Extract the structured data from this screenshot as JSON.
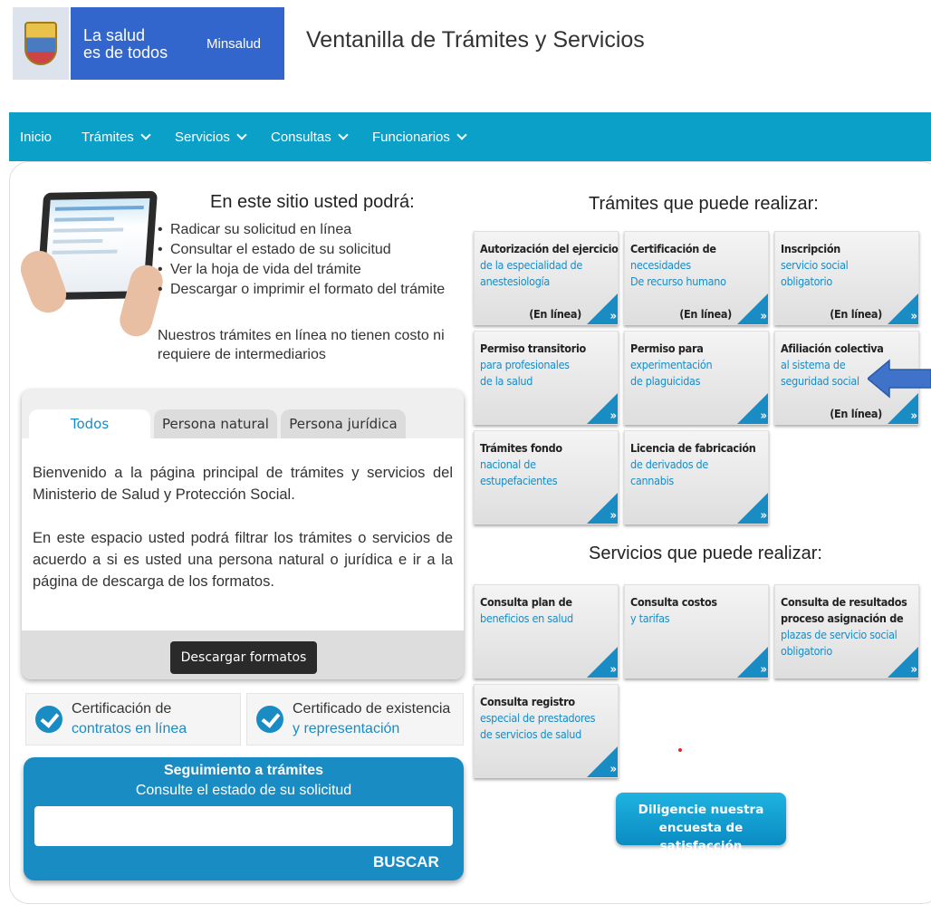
{
  "header": {
    "brand_line1": "La salud",
    "brand_line2": "es de todos",
    "brand_name": "Minsalud",
    "site_title": "Ventanilla de Trámites y Servicios"
  },
  "nav": {
    "items": [
      {
        "label": "Inicio",
        "has_dropdown": false
      },
      {
        "label": "Trámites",
        "has_dropdown": true
      },
      {
        "label": "Servicios",
        "has_dropdown": true
      },
      {
        "label": "Consultas",
        "has_dropdown": true
      },
      {
        "label": "Funcionarios",
        "has_dropdown": true
      }
    ]
  },
  "intro": {
    "heading": "En este sitio usted podrá:",
    "features": [
      "Radicar su solicitud en línea",
      "Consultar el estado de su solicitud",
      "Ver la hoja de vida del trámite",
      "Descargar o imprimir el formato del trámite"
    ],
    "note": "Nuestros trámites en línea no tienen costo ni requiere de intermediarios"
  },
  "tabs": {
    "items": [
      "Todos",
      "Persona natural",
      "Persona jurídica"
    ],
    "active": "Todos",
    "paragraph1": "Bienvenido a la página principal de trámites y servicios del Ministerio de Salud y Protección Social.",
    "paragraph2": "En este espacio usted podrá filtrar los trámites o servicios de acuerdo a si es usted una persona natural o jurídica e ir a la página de descarga de los formatos.",
    "download_button": "Descargar formatos"
  },
  "certs": [
    {
      "line1": "Certificación de",
      "line2": "contratos en línea"
    },
    {
      "line1": "Certificado de existencia",
      "line2": "y representación"
    }
  ],
  "tracking": {
    "title": "Seguimiento a trámites",
    "subtitle": "Consulte el estado de su solicitud",
    "input_value": "",
    "button": "BUSCAR"
  },
  "tramites": {
    "heading": "Trámites que puede realizar:",
    "cards": [
      {
        "title": "Autorización del ejercicio",
        "body": [
          "de la especialidad de",
          "anestesiología"
        ],
        "online": "(En línea)"
      },
      {
        "title": "Certificación de",
        "body": [
          "necesidades",
          "De recurso humano"
        ],
        "online": "(En línea)"
      },
      {
        "title": "Inscripción",
        "body": [
          "servicio social",
          "obligatorio"
        ],
        "online": "(En línea)"
      },
      {
        "title": "Permiso transitorio",
        "body": [
          "para profesionales",
          "de la salud"
        ],
        "online": ""
      },
      {
        "title": "Permiso para",
        "body": [
          "experimentación",
          "de plaguicidas"
        ],
        "online": ""
      },
      {
        "title": "Afiliación colectiva",
        "body": [
          "al sistema de",
          "seguridad social"
        ],
        "online": "(En línea)"
      },
      {
        "title": "Trámites fondo",
        "body": [
          "nacional de",
          "estupefacientes"
        ],
        "online": ""
      },
      {
        "title": "Licencia de fabricación",
        "body": [
          "de derivados de",
          "cannabis"
        ],
        "online": ""
      }
    ]
  },
  "servicios": {
    "heading": "Servicios que puede realizar:",
    "cards": [
      {
        "title": [
          "Consulta plan de"
        ],
        "body": [
          "beneficios en salud"
        ]
      },
      {
        "title": [
          "Consulta costos"
        ],
        "body": [
          "y tarifas"
        ]
      },
      {
        "title": [
          "Consulta de resultados",
          "proceso asignación de"
        ],
        "body": [
          "plazas de servicio social",
          "obligatorio"
        ]
      },
      {
        "title": [
          "Consulta registro"
        ],
        "body": [
          "especial de prestadores",
          "de servicios de salud"
        ]
      }
    ]
  },
  "survey_button": {
    "line1": "Diligencie nuestra",
    "line2": "encuesta de satisfacción"
  },
  "colors": {
    "nav_bg": "#0ba0c8",
    "brand_bg": "#3366cc",
    "accent": "#1a8cc4"
  },
  "card_arrow_glyph": "»"
}
